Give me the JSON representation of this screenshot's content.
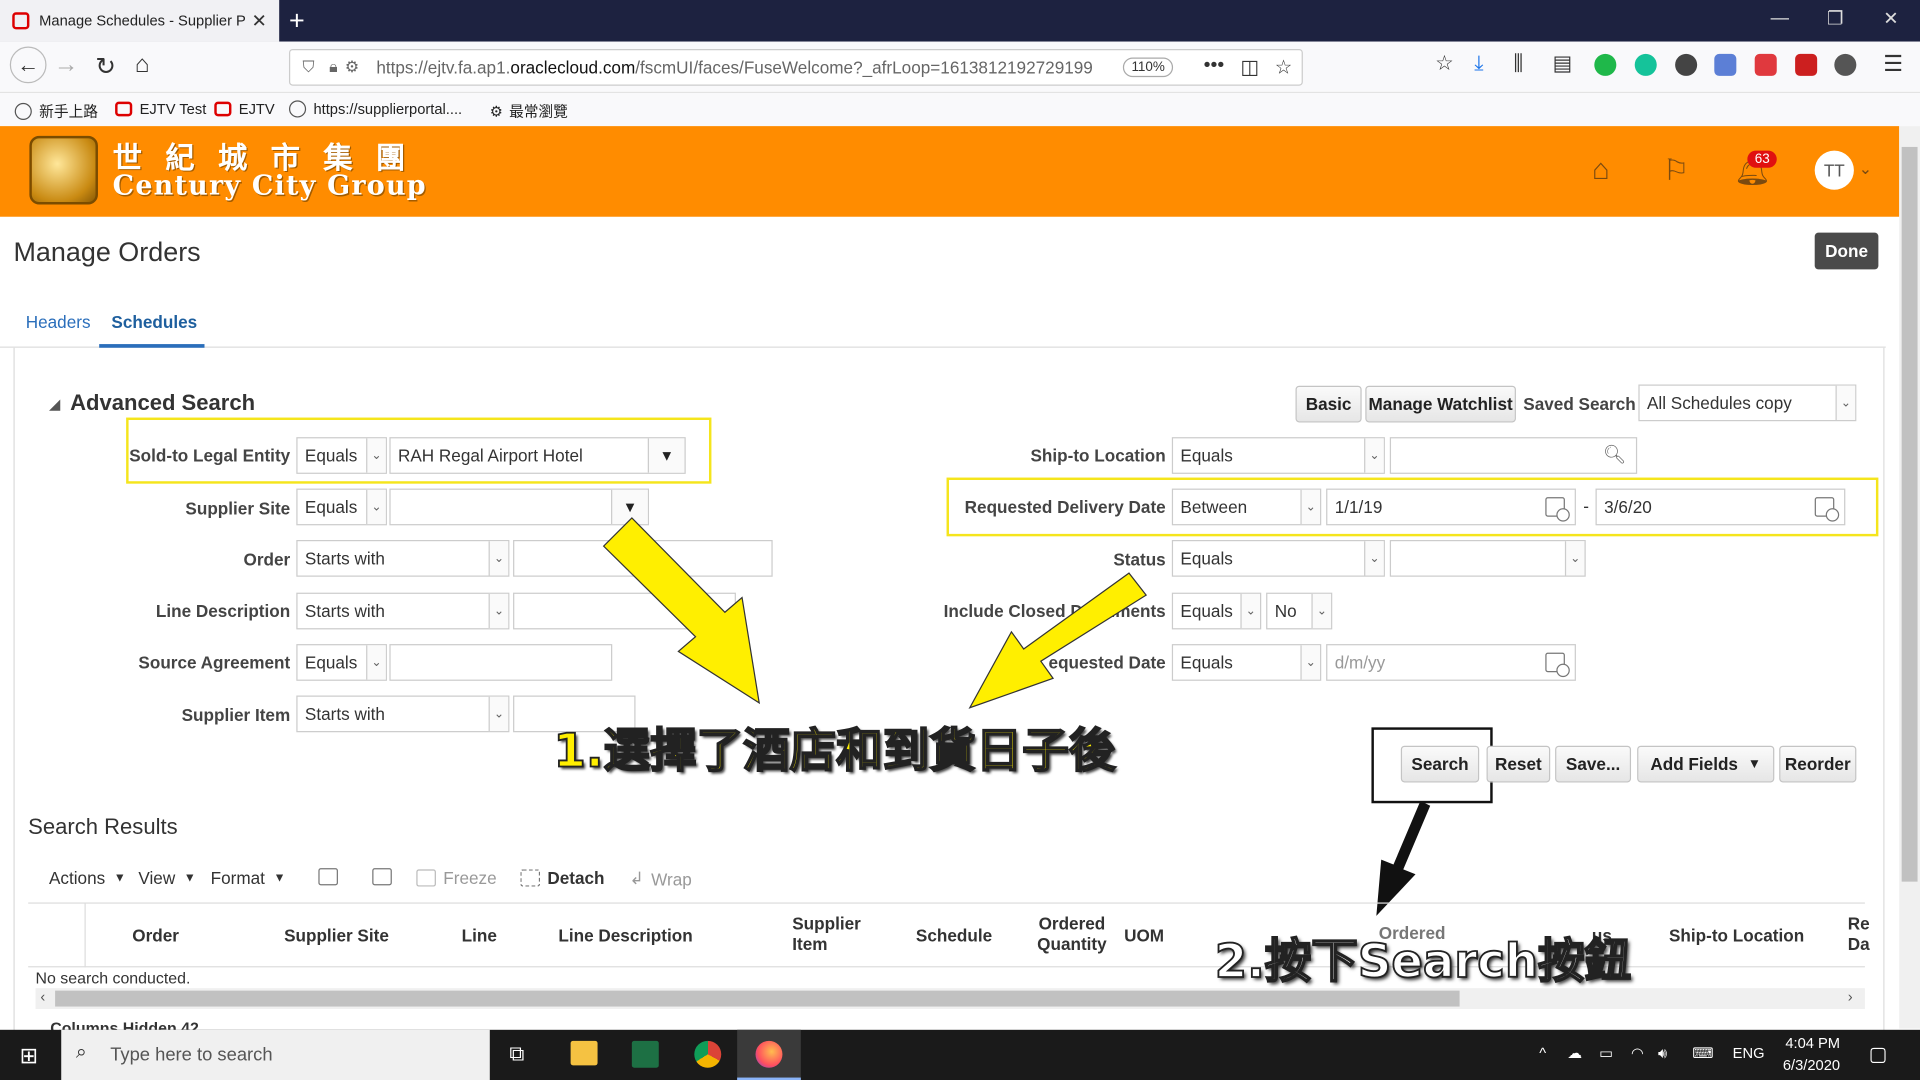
{
  "browser": {
    "tab_title": "Manage Schedules - Supplier P",
    "url_prefix": "https://ejtv.fa.ap1.",
    "url_domain": "oraclecloud.com",
    "url_rest": "/fscmUI/faces/FuseWelcome?_afrLoop=1613812192729199",
    "zoom": "110%",
    "bookmarks": [
      "新手上路",
      "EJTV Test",
      "EJTV",
      "https://supplierportal....",
      "最常瀏覽"
    ]
  },
  "brand": {
    "name_cn": "世紀城市集團",
    "name_en": "Century City Group",
    "notification_count": "63",
    "user_initials": "TT"
  },
  "page": {
    "title": "Manage Orders",
    "done_label": "Done",
    "tabs": [
      "Headers",
      "Schedules"
    ]
  },
  "search": {
    "section_title": "Advanced Search",
    "basic_label": "Basic",
    "watchlist_label": "Manage Watchlist",
    "saved_search_label": "Saved Search",
    "saved_search_value": "All Schedules copy",
    "fields": {
      "sold_to": {
        "label": "Sold-to Legal Entity",
        "op": "Equals",
        "value": "RAH Regal Airport Hotel"
      },
      "supplier_site": {
        "label": "Supplier Site",
        "op": "Equals",
        "value": ""
      },
      "order": {
        "label": "Order",
        "op": "Starts with",
        "value": ""
      },
      "line_description": {
        "label": "Line Description",
        "op": "Starts with",
        "value": ""
      },
      "source_agreement": {
        "label": "Source Agreement",
        "op": "Equals",
        "value": ""
      },
      "supplier_item": {
        "label": "Supplier Item",
        "op": "Starts with",
        "value": ""
      },
      "ship_to": {
        "label": "Ship-to Location",
        "op": "Equals",
        "value": ""
      },
      "req_delivery": {
        "label": "Requested Delivery Date",
        "op": "Between",
        "from": "1/1/19",
        "to": "3/6/20"
      },
      "status": {
        "label": "Status",
        "op": "Equals",
        "value": ""
      },
      "include_closed": {
        "label": "Include Closed D",
        "label_tail": "uments",
        "op": "Equals",
        "value": "No"
      },
      "requested_date": {
        "label": "equested Date",
        "op": "Equals",
        "placeholder": "d/m/yy"
      }
    },
    "buttons": {
      "search": "Search",
      "reset": "Reset",
      "save": "Save...",
      "add_fields": "Add Fields",
      "reorder": "Reorder"
    }
  },
  "annotations": {
    "step1": "1.選擇了酒店和到貨日子後",
    "step2": "2.按下Search按鈕"
  },
  "results": {
    "title": "Search Results",
    "toolbar": [
      "Actions",
      "View",
      "Format",
      "Freeze",
      "Detach",
      "Wrap"
    ],
    "columns": [
      "Order",
      "Supplier Site",
      "Line",
      "Line Description",
      "Supplier",
      "Item",
      "Schedule",
      "Ordered",
      "Quantity",
      "UOM",
      "Ordered",
      "us",
      "Ship-to Location",
      "Re",
      "Da"
    ],
    "empty_text": "No search conducted.",
    "hidden_columns": "Columns Hidden  42"
  },
  "taskbar": {
    "search_placeholder": "Type here to search",
    "lang": "ENG",
    "time": "4:04 PM",
    "date": "6/3/2020"
  }
}
